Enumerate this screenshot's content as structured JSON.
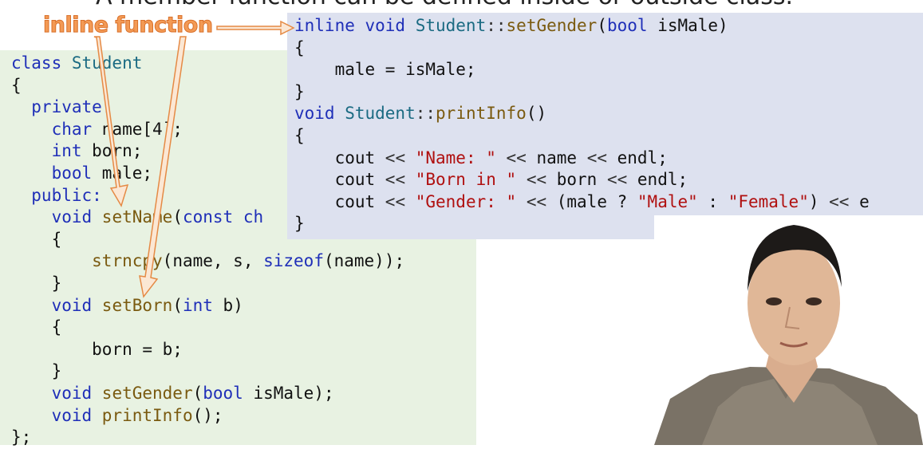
{
  "header": {
    "title": "A member function can be defined inside or outside class."
  },
  "annotation": {
    "label": "inline function"
  },
  "left_code": [
    [
      {
        "c": "kw",
        "t": "class "
      },
      {
        "c": "ty",
        "t": "Student"
      }
    ],
    [
      {
        "c": "pl",
        "t": "{"
      }
    ],
    [
      {
        "c": "kw",
        "t": "  private:"
      }
    ],
    [
      {
        "c": "kw",
        "t": "    char "
      },
      {
        "c": "pl",
        "t": "name["
      },
      {
        "c": "pl",
        "t": "4"
      },
      {
        "c": "pl",
        "t": "];"
      }
    ],
    [
      {
        "c": "kw",
        "t": "    int "
      },
      {
        "c": "pl",
        "t": "born;"
      }
    ],
    [
      {
        "c": "kw",
        "t": "    bool "
      },
      {
        "c": "pl",
        "t": "male;"
      }
    ],
    [
      {
        "c": "kw",
        "t": "  public:"
      }
    ],
    [
      {
        "c": "kw",
        "t": "    void "
      },
      {
        "c": "fn",
        "t": "setName"
      },
      {
        "c": "pl",
        "t": "("
      },
      {
        "c": "kw",
        "t": "const ch"
      }
    ],
    [
      {
        "c": "pl",
        "t": "    {"
      }
    ],
    [
      {
        "c": "pl",
        "t": "        "
      },
      {
        "c": "fn",
        "t": "strncpy"
      },
      {
        "c": "pl",
        "t": "(name, s, "
      },
      {
        "c": "kw",
        "t": "sizeof"
      },
      {
        "c": "pl",
        "t": "(name));"
      }
    ],
    [
      {
        "c": "pl",
        "t": "    }"
      }
    ],
    [
      {
        "c": "kw",
        "t": "    void "
      },
      {
        "c": "fn",
        "t": "setBorn"
      },
      {
        "c": "pl",
        "t": "("
      },
      {
        "c": "kw",
        "t": "int "
      },
      {
        "c": "pl",
        "t": "b)"
      }
    ],
    [
      {
        "c": "pl",
        "t": "    {"
      }
    ],
    [
      {
        "c": "pl",
        "t": "        born = b;"
      }
    ],
    [
      {
        "c": "pl",
        "t": "    }"
      }
    ],
    [
      {
        "c": "kw",
        "t": "    void "
      },
      {
        "c": "fn",
        "t": "setGender"
      },
      {
        "c": "pl",
        "t": "("
      },
      {
        "c": "kw",
        "t": "bool "
      },
      {
        "c": "pl",
        "t": "isMale);"
      }
    ],
    [
      {
        "c": "kw",
        "t": "    void "
      },
      {
        "c": "fn",
        "t": "printInfo"
      },
      {
        "c": "pl",
        "t": "();"
      }
    ],
    [
      {
        "c": "pl",
        "t": "};"
      }
    ]
  ],
  "right_code": [
    [
      {
        "c": "kw",
        "t": "inline void "
      },
      {
        "c": "ty",
        "t": "Student"
      },
      {
        "c": "op",
        "t": "::"
      },
      {
        "c": "fn",
        "t": "setGender"
      },
      {
        "c": "pl",
        "t": "("
      },
      {
        "c": "kw",
        "t": "bool "
      },
      {
        "c": "pl",
        "t": "isMale)"
      }
    ],
    [
      {
        "c": "pl",
        "t": "{"
      }
    ],
    [
      {
        "c": "pl",
        "t": "    male = isMale;"
      }
    ],
    [
      {
        "c": "pl",
        "t": "}"
      }
    ],
    [
      {
        "c": "kw",
        "t": "void "
      },
      {
        "c": "ty",
        "t": "Student"
      },
      {
        "c": "op",
        "t": "::"
      },
      {
        "c": "fn",
        "t": "printInfo"
      },
      {
        "c": "pl",
        "t": "()"
      }
    ],
    [
      {
        "c": "pl",
        "t": "{"
      }
    ],
    [
      {
        "c": "pl",
        "t": "    cout "
      },
      {
        "c": "op",
        "t": "<< "
      },
      {
        "c": "st",
        "t": "\"Name: \""
      },
      {
        "c": "op",
        "t": " << "
      },
      {
        "c": "pl",
        "t": "name "
      },
      {
        "c": "op",
        "t": "<< "
      },
      {
        "c": "pl",
        "t": "endl;"
      }
    ],
    [
      {
        "c": "pl",
        "t": "    cout "
      },
      {
        "c": "op",
        "t": "<< "
      },
      {
        "c": "st",
        "t": "\"Born in \""
      },
      {
        "c": "op",
        "t": " << "
      },
      {
        "c": "pl",
        "t": "born "
      },
      {
        "c": "op",
        "t": "<< "
      },
      {
        "c": "pl",
        "t": "endl;"
      }
    ],
    [
      {
        "c": "pl",
        "t": "    cout "
      },
      {
        "c": "op",
        "t": "<< "
      },
      {
        "c": "st",
        "t": "\"Gender: \""
      },
      {
        "c": "op",
        "t": " << "
      },
      {
        "c": "pl",
        "t": "(male ? "
      },
      {
        "c": "st",
        "t": "\"Male\""
      },
      {
        "c": "pl",
        "t": " : "
      },
      {
        "c": "st",
        "t": "\"Female\""
      },
      {
        "c": "pl",
        "t": ") "
      },
      {
        "c": "op",
        "t": "<< "
      },
      {
        "c": "pl",
        "t": "e"
      }
    ],
    [
      {
        "c": "pl",
        "t": "}"
      }
    ]
  ],
  "colors": {
    "left_bg": "#e8f2e2",
    "right_bg": "#dde1ef",
    "annotation": "#f39a55"
  }
}
